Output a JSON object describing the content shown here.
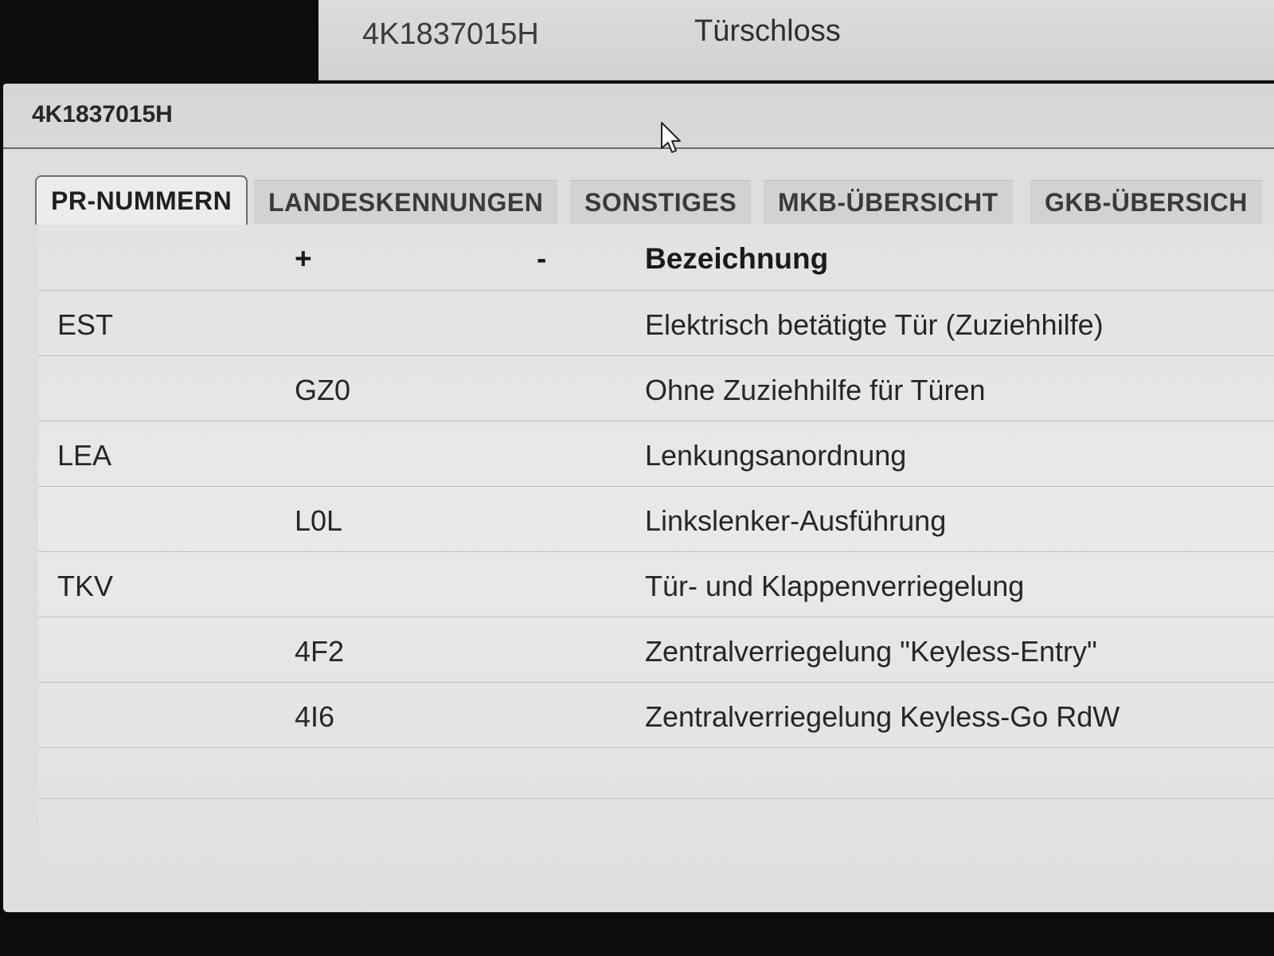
{
  "background_window": {
    "part_number": "4K1837015H",
    "part_name": "Türschloss"
  },
  "dialog": {
    "title": "4K1837015H"
  },
  "tabs": [
    {
      "label": "PR-NUMMERN",
      "active": true
    },
    {
      "label": "LANDESKENNUNGEN",
      "active": false
    },
    {
      "label": "SONSTIGES",
      "active": false
    },
    {
      "label": "MKB-ÜBERSICHT",
      "active": false
    },
    {
      "label": "GKB-ÜBERSICH",
      "active": false
    }
  ],
  "table": {
    "headers": {
      "code": "",
      "plus": "+",
      "minus": "-",
      "description": "Bezeichnung"
    },
    "rows": [
      {
        "code": "EST",
        "plus": "",
        "minus": "",
        "description": "Elektrisch betätigte Tür (Zuziehhilfe)"
      },
      {
        "code": "",
        "plus": "GZ0",
        "minus": "",
        "description": "Ohne Zuziehhilfe für Türen"
      },
      {
        "code": "LEA",
        "plus": "",
        "minus": "",
        "description": "Lenkungsanordnung"
      },
      {
        "code": "",
        "plus": "L0L",
        "minus": "",
        "description": "Linkslenker-Ausführung"
      },
      {
        "code": "TKV",
        "plus": "",
        "minus": "",
        "description": "Tür- und Klappenverriegelung"
      },
      {
        "code": "",
        "plus": "4F2",
        "minus": "",
        "description": "Zentralverriegelung \"Keyless-Entry\""
      },
      {
        "code": "",
        "plus": "4I6",
        "minus": "",
        "description": "Zentralverriegelung Keyless-Go RdW"
      }
    ]
  },
  "icons": {
    "cursor": "mouse-pointer-icon"
  },
  "colors": {
    "window_bg": "#dedede",
    "tab_active": "#ececec",
    "tab_inactive": "#d2d2d2",
    "text": "#262626"
  }
}
